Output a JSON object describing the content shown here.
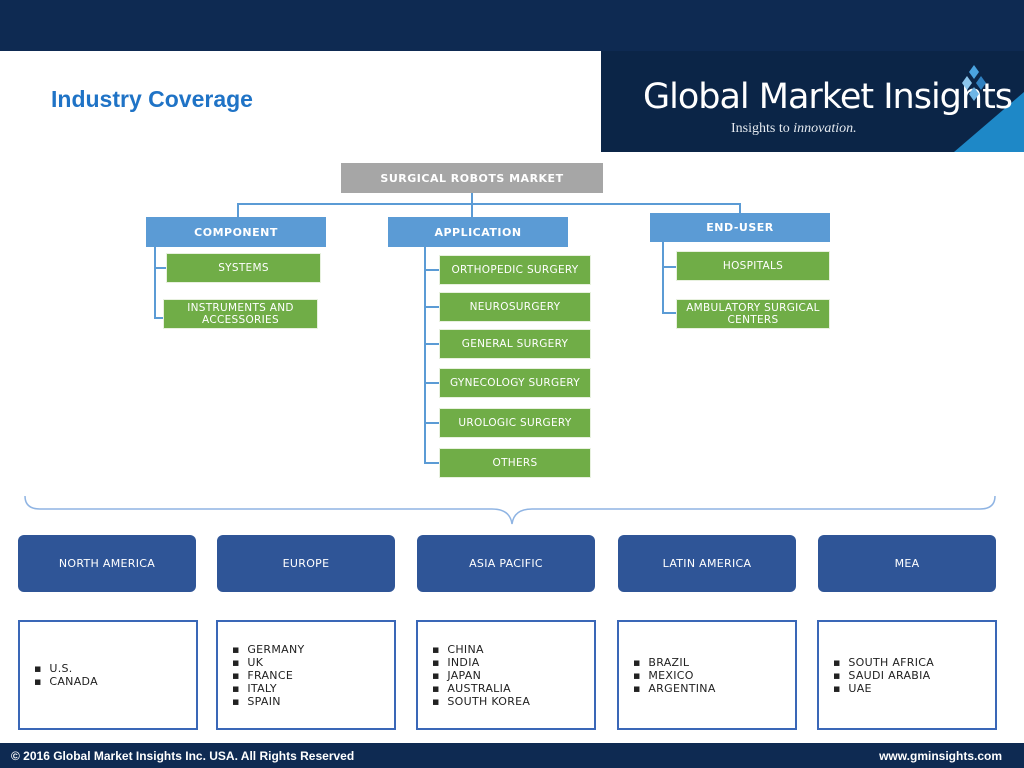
{
  "slide": {
    "title": "Industry Coverage"
  },
  "logo": {
    "name": "Global Market Insights",
    "tagline_prefix": "Insights to",
    "tagline_emphasis": "innovation."
  },
  "colors": {
    "header_bg": "#0e2a52",
    "title": "#1f73c6",
    "root_box": "#a6a6a6",
    "category_box": "#5b9bd5",
    "leaf_box": "#70ad47",
    "region_box": "#2f5597",
    "connector": "#5b9bd5"
  },
  "tree": {
    "root": "SURGICAL ROBOTS MARKET",
    "categories": [
      {
        "label": "COMPONENT",
        "items": [
          "SYSTEMS",
          "INSTRUMENTS AND ACCESSORIES"
        ]
      },
      {
        "label": "APPLICATION",
        "items": [
          "ORTHOPEDIC SURGERY",
          "NEUROSURGERY",
          "GENERAL SURGERY",
          "GYNECOLOGY SURGERY",
          "UROLOGIC SURGERY",
          "OTHERS"
        ]
      },
      {
        "label": "END-USER",
        "items": [
          "HOSPITALS",
          "AMBULATORY SURGICAL CENTERS"
        ]
      }
    ]
  },
  "regions": [
    {
      "label": "NORTH AMERICA",
      "countries": [
        "U.S.",
        "CANADA"
      ]
    },
    {
      "label": "EUROPE",
      "countries": [
        "GERMANY",
        "UK",
        "FRANCE",
        "ITALY",
        "SPAIN"
      ]
    },
    {
      "label": "ASIA PACIFIC",
      "countries": [
        "CHINA",
        "INDIA",
        "JAPAN",
        "AUSTRALIA",
        "SOUTH KOREA"
      ]
    },
    {
      "label": "LATIN AMERICA",
      "countries": [
        "BRAZIL",
        "MEXICO",
        "ARGENTINA"
      ]
    },
    {
      "label": "MEA",
      "countries": [
        "SOUTH AFRICA",
        "SAUDI ARABIA",
        "UAE"
      ]
    }
  ],
  "footer": {
    "copyright": "© 2016 Global Market Insights Inc. USA.  All Rights Reserved",
    "website": "www.gminsights.com"
  }
}
